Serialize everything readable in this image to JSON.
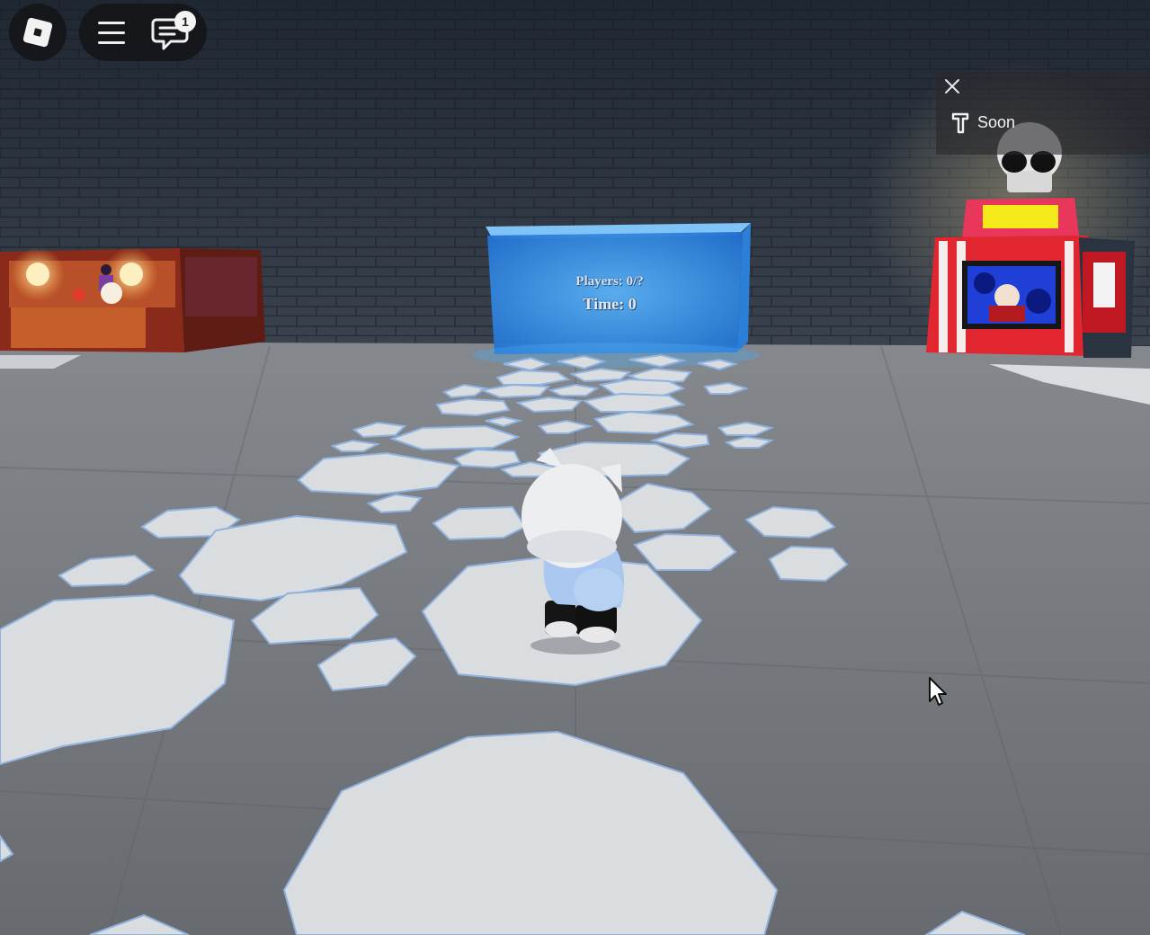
{
  "hud": {
    "chat_badge_count": "1",
    "icons": {
      "roblox": "roblox-logo-icon",
      "menu": "hamburger-menu-icon",
      "chat": "chat-bubble-icon",
      "close": "close-icon",
      "soon": "hammer-icon"
    }
  },
  "panel": {
    "soon_label": "Soon"
  },
  "billboard": {
    "players_text": "Players: 0/?",
    "time_text": "Time: 0"
  },
  "colors": {
    "wall": "#2c3440",
    "floor": "#6d7176",
    "tiles": "#d9dcdf",
    "portal": "#3a8fe0",
    "kiosk_red": "#d7192b",
    "kiosk_sign": "#f5ea1a"
  }
}
